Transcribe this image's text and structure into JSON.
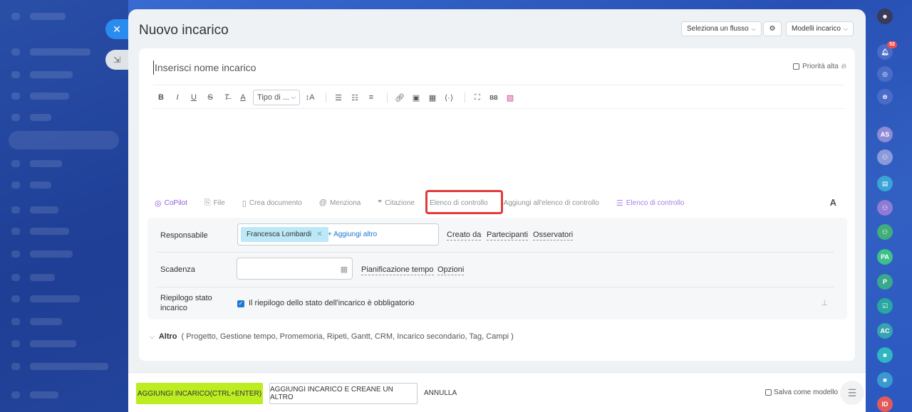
{
  "background": {
    "rail_badge_count": "52",
    "rail_avatars": [
      "AS",
      "PA",
      "P",
      "AC",
      "ID"
    ]
  },
  "header": {
    "title": "Nuovo incarico",
    "flow_select": "Seleziona un flusso",
    "templates": "Modelli incarico"
  },
  "editor": {
    "name_placeholder": "Inserisci nome incarico",
    "priority_label": "Priorità alta",
    "font_type_label": "Tipo di ...",
    "bottom_tools": {
      "copilot": "CoPilot",
      "file": "File",
      "create_doc": "Crea documento",
      "mention": "Menziona",
      "quote": "Citazione",
      "checklist": "Elenco di controllo",
      "add_to_checklist": "Aggiungi all'elenco di controllo",
      "checklist_alt": "Elenco di controllo"
    },
    "font_toggle": "A"
  },
  "fields": {
    "responsible_label": "Responsabile",
    "responsible_person": "Francesca Lombardi",
    "add_more": "+ Aggiungi altro",
    "created_by": "Creato da",
    "participants": "Partecipanti",
    "observers": "Osservatori",
    "deadline_label": "Scadenza",
    "time_planning": "Pianificazione tempo",
    "options": "Opzioni",
    "summary_label_1": "Riepilogo stato",
    "summary_label_2": "incarico",
    "summary_check_text": "Il riepilogo dello stato dell'incarico è obbligatorio"
  },
  "altro": {
    "label": "Altro",
    "items": "( Progetto,  Gestione tempo,  Promemoria,  Ripeti,  Gantt,  CRM,  Incarico secondario,  Tag,  Campi )"
  },
  "footer": {
    "add_task": "AGGIUNGI INCARICO(CTRL+ENTER)",
    "add_and_create": "AGGIUNGI INCARICO E CREANE UN ALTRO",
    "cancel": "ANNULLA",
    "save_template": "Salva come modello"
  },
  "colors": {
    "primary_button": "#bbed21",
    "highlight_border": "#e23b3b",
    "chip_bg": "#bde8f7",
    "link_blue": "#1976d2"
  }
}
